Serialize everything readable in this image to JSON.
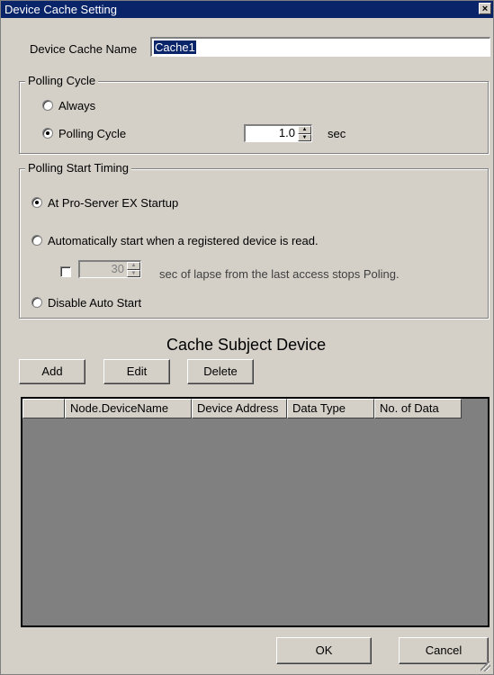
{
  "window": {
    "title": "Device Cache Setting",
    "close_glyph": "×"
  },
  "cache_name": {
    "label": "Device Cache Name",
    "value": "Cache1"
  },
  "polling_cycle": {
    "legend": "Polling Cycle",
    "always_label": "Always",
    "cycle_label": "Polling Cycle",
    "cycle_value": "1.0",
    "unit": "sec",
    "selected": "cycle"
  },
  "polling_start": {
    "legend": "Polling Start Timing",
    "at_startup_label": "At Pro-Server EX Startup",
    "auto_start_label": "Automatically start when a registered device is read.",
    "lapse_value": "30",
    "lapse_label": "sec of lapse from the last access stops Poling.",
    "disable_label": "Disable Auto Start",
    "selected": "at_startup"
  },
  "subject": {
    "title": "Cache Subject Device",
    "add_label": "Add",
    "edit_label": "Edit",
    "delete_label": "Delete",
    "columns": [
      "",
      "Node.DeviceName",
      "Device Address",
      "Data Type",
      "No. of Data"
    ]
  },
  "footer": {
    "ok_label": "OK",
    "cancel_label": "Cancel"
  },
  "colors": {
    "titlebar": "#0a246a",
    "face": "#d4d0c8",
    "list_bg": "#808080"
  },
  "icons": [
    "close-icon",
    "spin-up-icon",
    "spin-down-icon",
    "resize-grip-icon"
  ]
}
